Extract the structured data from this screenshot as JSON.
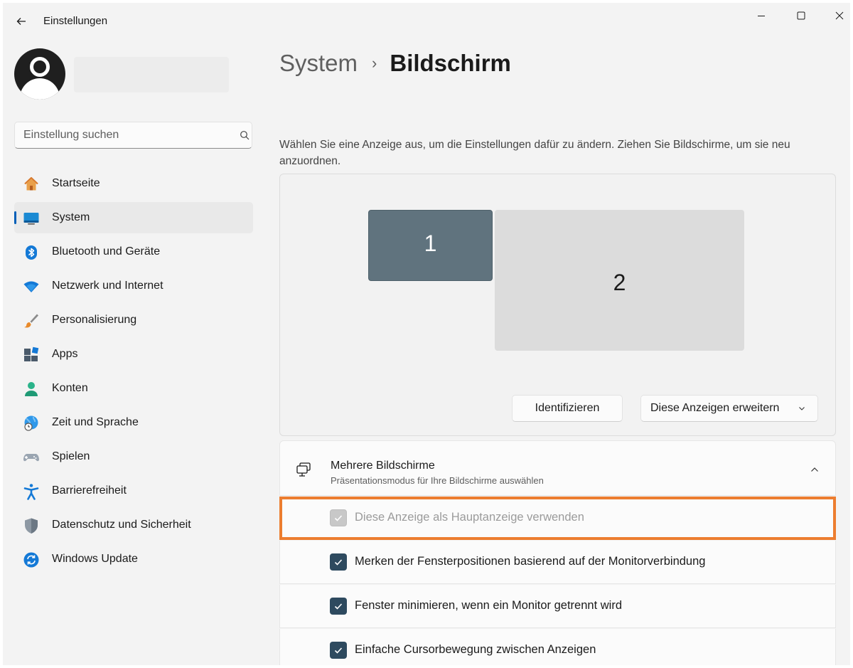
{
  "window": {
    "title": "Einstellungen"
  },
  "sidebar": {
    "search_placeholder": "Einstellung suchen",
    "items": [
      {
        "label": "Startseite",
        "icon": "home-icon"
      },
      {
        "label": "System",
        "icon": "monitor-icon",
        "active": true
      },
      {
        "label": "Bluetooth und Geräte",
        "icon": "bluetooth-icon"
      },
      {
        "label": "Netzwerk und Internet",
        "icon": "wifi-icon"
      },
      {
        "label": "Personalisierung",
        "icon": "brush-icon"
      },
      {
        "label": "Apps",
        "icon": "apps-icon"
      },
      {
        "label": "Konten",
        "icon": "person-icon"
      },
      {
        "label": "Zeit und Sprache",
        "icon": "globe-clock-icon"
      },
      {
        "label": "Spielen",
        "icon": "gamepad-icon"
      },
      {
        "label": "Barrierefreiheit",
        "icon": "accessibility-icon"
      },
      {
        "label": "Datenschutz und Sicherheit",
        "icon": "shield-icon"
      },
      {
        "label": "Windows Update",
        "icon": "update-icon"
      }
    ]
  },
  "main": {
    "breadcrumb_parent": "System",
    "breadcrumb_separator": "›",
    "breadcrumb_current": "Bildschirm",
    "intro": "Wählen Sie eine Anzeige aus, um die Einstellungen dafür zu ändern. Ziehen Sie Bildschirme, um sie neu anzuordnen.",
    "monitors": [
      {
        "label": "1",
        "selected": true
      },
      {
        "label": "2",
        "selected": false
      }
    ],
    "identify_label": "Identifizieren",
    "extend_label": "Diese Anzeigen erweitern",
    "multi": {
      "title": "Mehrere Bildschirme",
      "subtitle": "Präsentationsmodus für Ihre Bildschirme auswählen",
      "expanded": true
    },
    "options": [
      {
        "label": "Diese Anzeige als Hauptanzeige verwenden",
        "checked": true,
        "disabled": true,
        "highlighted": true
      },
      {
        "label": "Merken der Fensterpositionen basierend auf der Monitorverbindung",
        "checked": true,
        "disabled": false
      },
      {
        "label": "Fenster minimieren, wenn ein Monitor getrennt wird",
        "checked": true,
        "disabled": false
      },
      {
        "label": "Einfache Cursorbewegung zwischen Anzeigen",
        "checked": true,
        "disabled": false
      }
    ]
  },
  "colors": {
    "accent": "#005fb8",
    "highlight": "#ec7d2f",
    "checkbox": "#2e4a5f",
    "monitor_selected": "#60737e"
  }
}
